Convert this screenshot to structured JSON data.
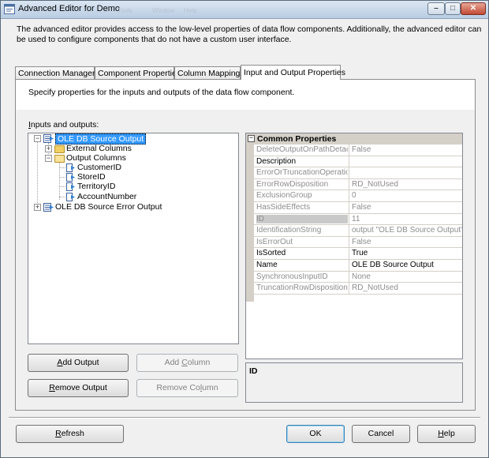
{
  "window": {
    "title": "Advanced Editor for Demo",
    "ghost_menu": [
      "Tools",
      "Window",
      "Help"
    ],
    "minimize_glyph": "–",
    "maximize_glyph": "□",
    "close_glyph": "✕"
  },
  "description": "The advanced editor provides access to the low-level properties of data flow components. Additionally, the advanced editor can be used to configure components that do not have a custom user interface.",
  "tabs": [
    {
      "label": "Connection Managers",
      "active": false
    },
    {
      "label": "Component Properties",
      "active": false
    },
    {
      "label": "Column Mappings",
      "active": false
    },
    {
      "label": "Input and Output Properties",
      "active": true
    }
  ],
  "panel": {
    "hint": "Specify properties for the inputs and outputs of the data flow component.",
    "io_label_mnemonic": "I",
    "io_label_rest": "nputs and outputs:"
  },
  "tree": {
    "output": "OLE DB Source Output",
    "external_columns": "External Columns",
    "output_columns": "Output Columns",
    "columns": [
      "CustomerID",
      "StoreID",
      "TerritoryID",
      "AccountNumber"
    ],
    "error_output": "OLE DB Source Error Output",
    "expand_plus": "+",
    "expand_minus": "−"
  },
  "properties": {
    "category": "Common Properties",
    "category_glyph": "−",
    "rows": [
      {
        "name": "DeleteOutputOnPathDetached",
        "value": "False",
        "readonly": true
      },
      {
        "name": "Description",
        "value": "",
        "readonly": false
      },
      {
        "name": "ErrorOrTruncationOperation",
        "value": "",
        "readonly": true
      },
      {
        "name": "ErrorRowDisposition",
        "value": "RD_NotUsed",
        "readonly": true
      },
      {
        "name": "ExclusionGroup",
        "value": "0",
        "readonly": true
      },
      {
        "name": "HasSideEffects",
        "value": "False",
        "readonly": true
      },
      {
        "name": "ID",
        "value": "11",
        "readonly": true,
        "selected": true
      },
      {
        "name": "IdentificationString",
        "value": "output \"OLE DB Source Output\" (11)",
        "readonly": true
      },
      {
        "name": "IsErrorOut",
        "value": "False",
        "readonly": true
      },
      {
        "name": "IsSorted",
        "value": "True",
        "readonly": false
      },
      {
        "name": "Name",
        "value": "OLE DB Source Output",
        "readonly": false
      },
      {
        "name": "SynchronousInputID",
        "value": "None",
        "readonly": true
      },
      {
        "name": "TruncationRowDisposition",
        "value": "RD_NotUsed",
        "readonly": true
      }
    ],
    "description_title": "ID"
  },
  "buttons": {
    "add_output": {
      "mn": "A",
      "rest": "dd Output"
    },
    "add_column": {
      "pre": "Add ",
      "mn": "C",
      "rest": "olumn"
    },
    "remove_output": {
      "mn": "R",
      "rest": "emove Output"
    },
    "remove_column": {
      "pre": "Remove Co",
      "mn": "l",
      "rest": "umn"
    },
    "refresh": {
      "mn": "R",
      "rest": "efresh"
    },
    "ok": "OK",
    "cancel": "Cancel",
    "help": {
      "mn": "H",
      "rest": "elp"
    }
  }
}
